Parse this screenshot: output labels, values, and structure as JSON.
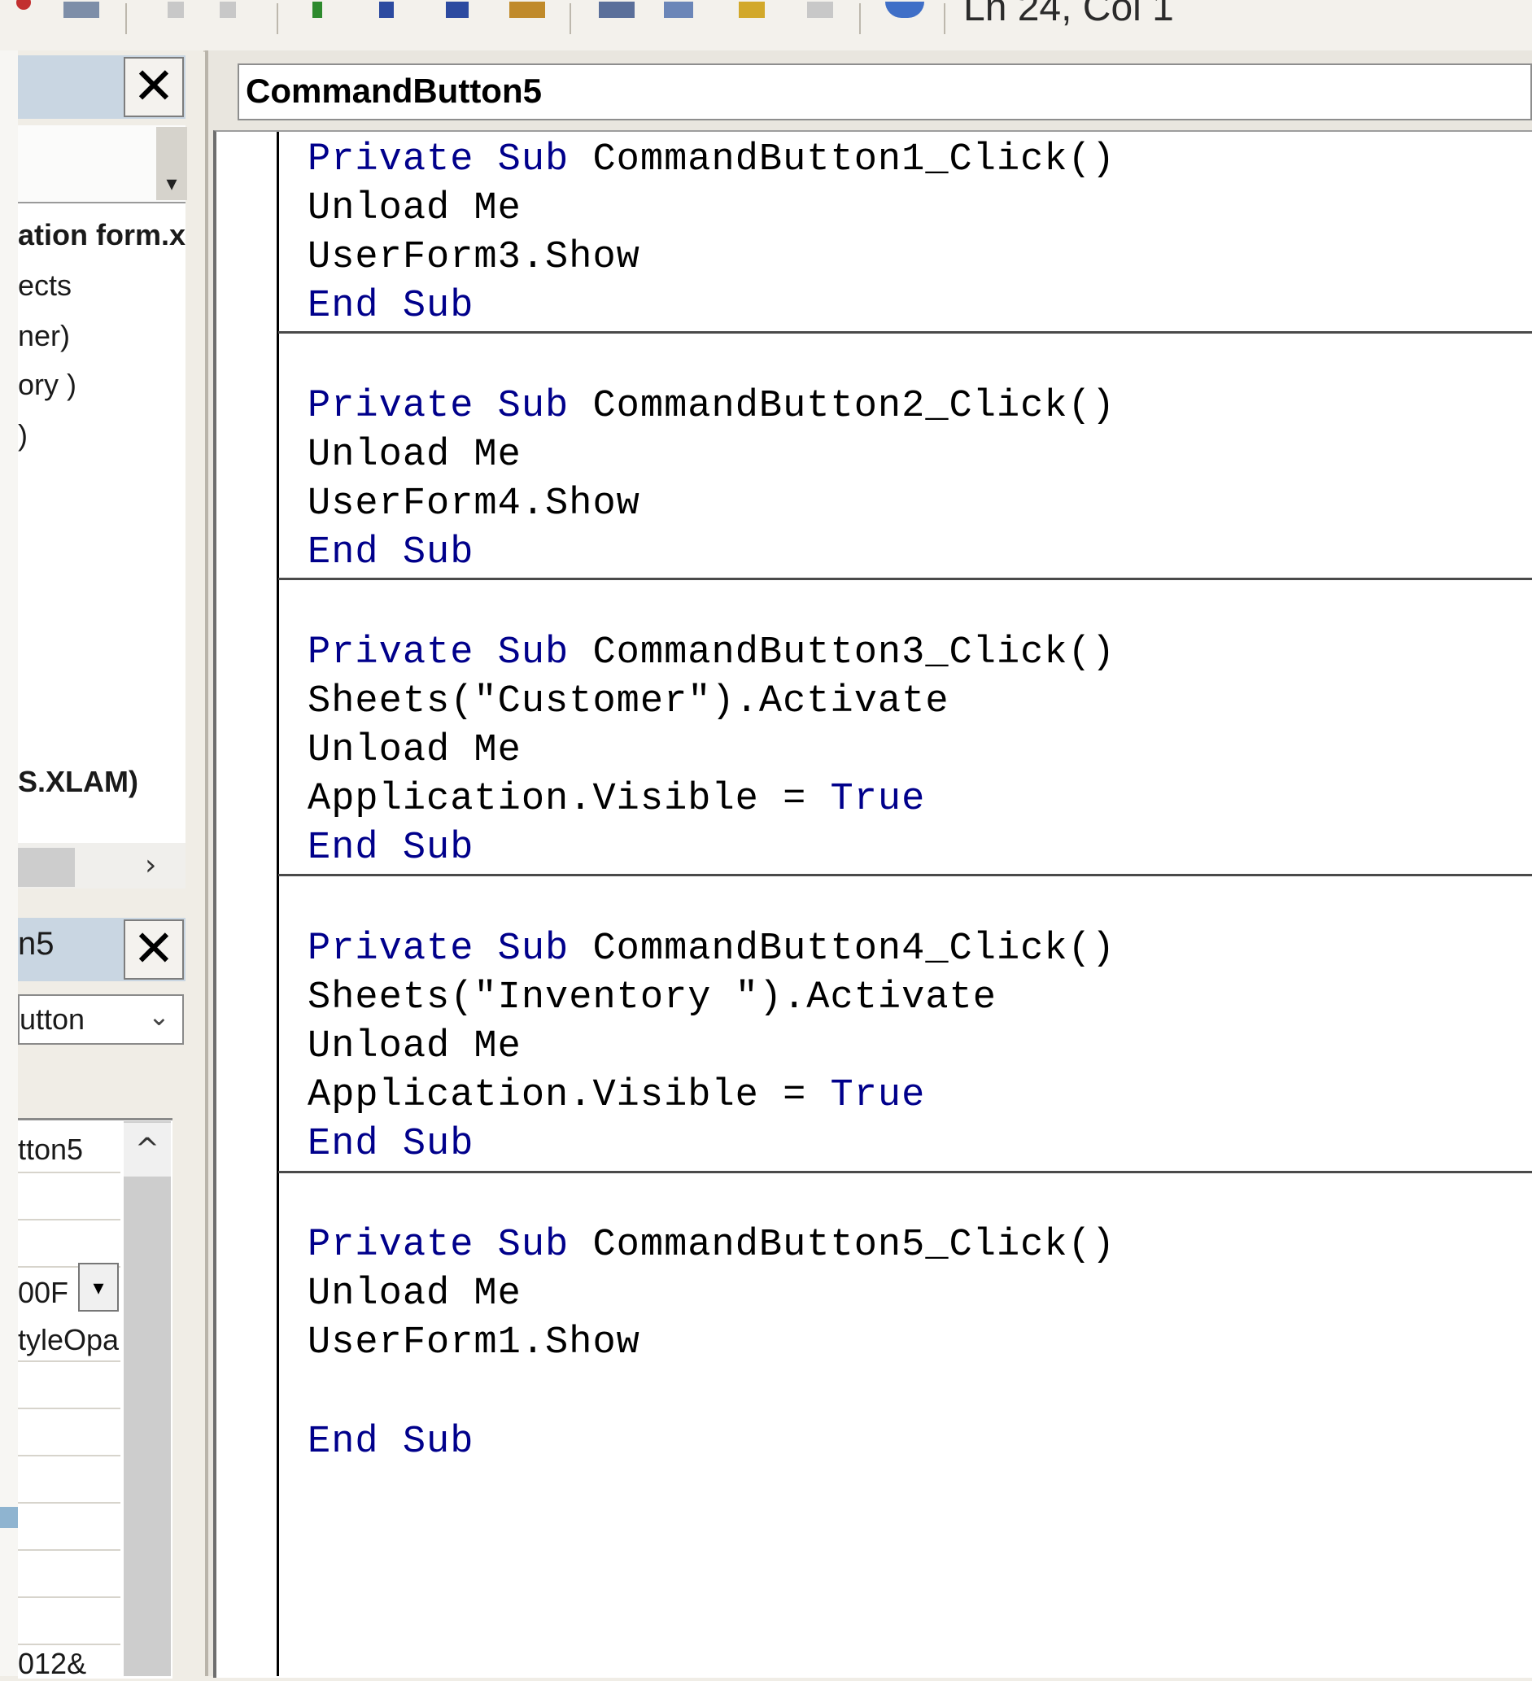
{
  "toolbar": {
    "status": "Ln 24, Col 1"
  },
  "left_pane": {
    "project_panel_title": "",
    "tree_items": [
      "ation form.x",
      "ects",
      "ner)",
      "ory )",
      ")",
      "S.XLAM)"
    ],
    "properties_panel_title": "n5",
    "object_combo_value": "utton",
    "property_values": [
      "tton5",
      "00F",
      "tyleOpa",
      "012&"
    ]
  },
  "editor": {
    "procedure_dropdown_value": "CommandButton5",
    "code_lines": [
      "Private Sub CommandButton1_Click()",
      "Unload Me",
      "UserForm3.Show",
      "End Sub",
      "Private Sub CommandButton2_Click()",
      "Unload Me",
      "UserForm4.Show",
      "End Sub",
      "Private Sub CommandButton3_Click()",
      "Sheets(\"Customer\").Activate",
      "Unload Me",
      "Application.Visible = True",
      "End Sub",
      "Private Sub CommandButton4_Click()",
      "Sheets(\"Inventory \").Activate",
      "Unload Me",
      "Application.Visible = True",
      "End Sub",
      "Private Sub CommandButton5_Click()",
      "Unload Me",
      "UserForm1.Show",
      "End Sub"
    ]
  },
  "colors": {
    "keyword": "#00008b",
    "panel_title_bg": "#c9d6e2"
  }
}
